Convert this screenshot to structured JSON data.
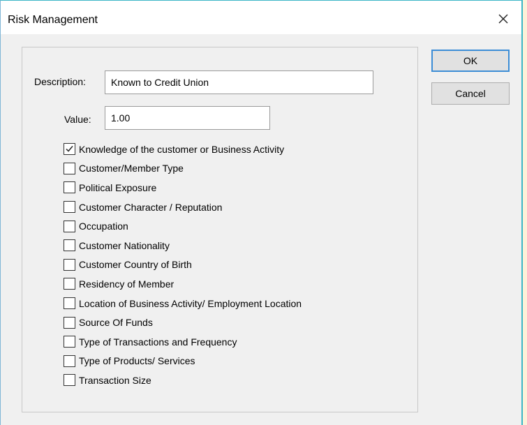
{
  "window": {
    "title": "Risk Management"
  },
  "form": {
    "description_label": "Description:",
    "description_value": "Known to Credit Union",
    "value_label": "Value:",
    "value_value": "1.00"
  },
  "buttons": {
    "ok_label": "OK",
    "cancel_label": "Cancel"
  },
  "checkboxes": [
    {
      "label": "Knowledge of the customer or Business Activity",
      "checked": true
    },
    {
      "label": "Customer/Member Type",
      "checked": false
    },
    {
      "label": "Political Exposure",
      "checked": false
    },
    {
      "label": "Customer Character / Reputation",
      "checked": false
    },
    {
      "label": "Occupation",
      "checked": false
    },
    {
      "label": "Customer Nationality",
      "checked": false
    },
    {
      "label": "Customer Country of Birth",
      "checked": false
    },
    {
      "label": "Residency of Member",
      "checked": false
    },
    {
      "label": "Location of Business Activity/ Employment Location",
      "checked": false
    },
    {
      "label": "Source Of Funds",
      "checked": false
    },
    {
      "label": "Type of Transactions and Frequency",
      "checked": false
    },
    {
      "label": "Type of Products/ Services",
      "checked": false
    },
    {
      "label": "Transaction Size",
      "checked": false
    }
  ],
  "colors": {
    "default_button_border": "#3c8dd6",
    "window_border": "#3ab6c6",
    "dialog_background": "#f0f0f0"
  },
  "icons": {
    "close": "close-icon",
    "check": "checkmark-icon"
  }
}
